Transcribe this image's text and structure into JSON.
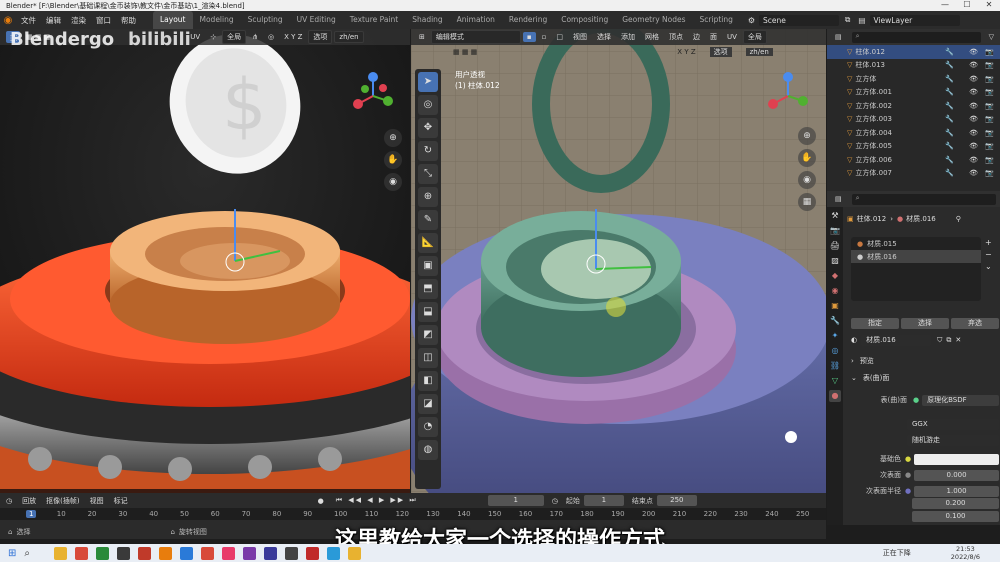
{
  "titlebar": {
    "text": "Blender* [F:\\Blender\\基础课程\\金币装饰\\教文件\\金币基站\\1_渲染4.blend]",
    "min": "—",
    "max": "☐",
    "close": "✕"
  },
  "menubar": {
    "menus": [
      "文件",
      "编辑",
      "渲染",
      "窗口",
      "帮助"
    ],
    "workspaces": [
      "Layout",
      "Modeling",
      "Sculpting",
      "UV Editing",
      "Texture Paint",
      "Shading",
      "Animation",
      "Rendering",
      "Compositing",
      "Geometry Nodes",
      "Scripting"
    ],
    "active_workspace": "Layout",
    "scene": "Scene",
    "view_layer": "ViewLayer"
  },
  "watermark": {
    "brand": "Blendergo",
    "site": "bilibili"
  },
  "left_viewport": {
    "header": {
      "uv": "UV",
      "global": "全局",
      "xyz": "X Y Z",
      "options": "选项",
      "lang": "zh/en"
    }
  },
  "right_viewport": {
    "header": {
      "mode": "编辑模式",
      "menus": [
        "视图",
        "选择",
        "添加",
        "网格",
        "顶点",
        "边",
        "面",
        "UV"
      ],
      "global": "全局",
      "options": "选项",
      "lang": "zh/en",
      "xyz": "X Y Z"
    },
    "info_line1": "用户透视",
    "info_line2": "(1) 柱体.012"
  },
  "outliner": {
    "items": [
      {
        "name": "柱体.012",
        "selected": true
      },
      {
        "name": "柱体.013",
        "selected": false
      },
      {
        "name": "立方体",
        "selected": false
      },
      {
        "name": "立方体.001",
        "selected": false
      },
      {
        "name": "立方体.002",
        "selected": false
      },
      {
        "name": "立方体.003",
        "selected": false
      },
      {
        "name": "立方体.004",
        "selected": false
      },
      {
        "name": "立方体.005",
        "selected": false
      },
      {
        "name": "立方体.006",
        "selected": false
      },
      {
        "name": "立方体.007",
        "selected": false
      }
    ]
  },
  "properties": {
    "breadcrumb_object": "柱体.012",
    "breadcrumb_material": "材质.016",
    "slots": [
      "材质.015",
      "材质.016"
    ],
    "assign": "指定",
    "select": "选择",
    "deselect": "弃选",
    "material_name": "材质.016",
    "preview": "预览",
    "surface": "表(曲)面",
    "surface_label": "表(曲)面",
    "surface_value": "原理化BSDF",
    "distribution": "GGX",
    "subsurface_method": "随机游走",
    "base_color_label": "基础色",
    "subsurface_label": "次表面",
    "subsurface_value": "0.000",
    "subsurface_radius_label": "次表面半径",
    "radius_values": [
      "1.000",
      "0.200",
      "0.100"
    ]
  },
  "timeline": {
    "menus": [
      "回放",
      "抠像(插帧)",
      "视图",
      "标记"
    ],
    "current_frame": "1",
    "start_label": "起始",
    "start": "1",
    "end_label": "结束点",
    "end": "250",
    "ruler": [
      "1",
      "10",
      "20",
      "30",
      "40",
      "50",
      "60",
      "70",
      "80",
      "90",
      "100",
      "110",
      "120",
      "130",
      "140",
      "150",
      "160",
      "170",
      "180",
      "190",
      "200",
      "210",
      "220",
      "230",
      "240",
      "250"
    ]
  },
  "statusbar": {
    "select": "选择",
    "rotate": "旋转视图"
  },
  "subtitle": "这里教给大家一个选择的操作方式",
  "taskbar": {
    "search": "⌕",
    "now_playing": "正在下降",
    "time": "21:53",
    "date": "2022/8/6"
  },
  "colors": {
    "accent": "#4772b3",
    "selected_row": "#334d80",
    "orange_obj": "#e09a3c"
  }
}
